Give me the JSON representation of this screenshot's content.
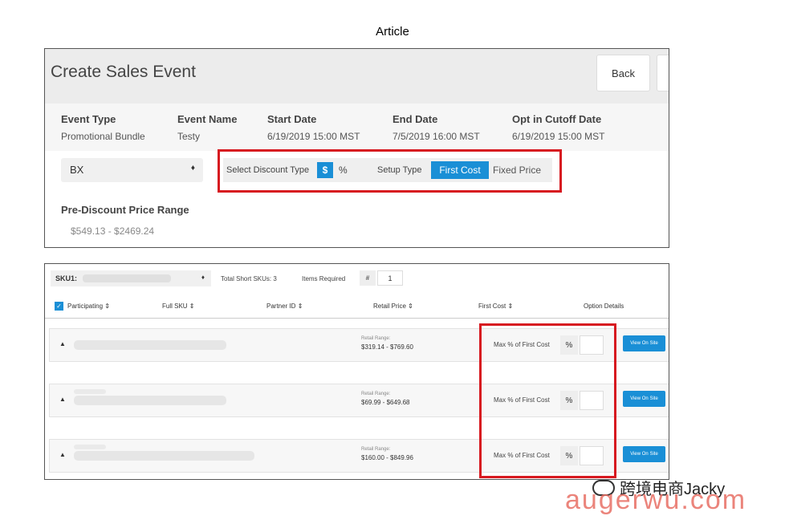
{
  "page_label": "Article",
  "panel1": {
    "title": "Create Sales Event",
    "back_label": "Back",
    "info": [
      {
        "header": "Event Type",
        "value": "Promotional Bundle"
      },
      {
        "header": "Event Name",
        "value": "Testy"
      },
      {
        "header": "Start Date",
        "value": "6/19/2019 15:00 MST"
      },
      {
        "header": "End Date",
        "value": "7/5/2019 16:00 MST"
      },
      {
        "header": "Opt in Cutoff Date",
        "value": "6/19/2019 15:00 MST"
      }
    ],
    "bx_select": "BX",
    "select_discount_type_label": "Select Discount Type",
    "dollar_label": "$",
    "percent_label": "%",
    "setup_type_label": "Setup Type",
    "first_cost_label": "First Cost",
    "fixed_price_label": "Fixed Price",
    "pre_discount_header": "Pre-Discount Price Range",
    "pre_discount_value": "$549.13 - $2469.24",
    "caret": "♦"
  },
  "panel2": {
    "sku_label": "SKU1:",
    "total_short_skus": "Total Short SKUs: 3",
    "items_required": "Items Required",
    "hash": "#",
    "items_required_value": "1",
    "columns": {
      "participating": "Participating",
      "full_sku": "Full SKU",
      "partner_id": "Partner ID",
      "retail_price": "Retail Price",
      "first_cost": "First Cost",
      "option_details": "Option Details"
    },
    "sort_icon": "⇕",
    "check": "✓",
    "rows": [
      {
        "retail_range_label": "Retail Range:",
        "retail_range": "$319.14 - $769.60",
        "max_label": "Max % of First Cost",
        "pct": "%",
        "view": "View On Site"
      },
      {
        "retail_range_label": "Retail Range:",
        "retail_range": "$69.99 - $649.68",
        "max_label": "Max % of First Cost",
        "pct": "%",
        "view": "View On Site"
      },
      {
        "retail_range_label": "Retail Range:",
        "retail_range": "$160.00 - $849.96",
        "max_label": "Max % of First Cost",
        "pct": "%",
        "view": "View On Site"
      }
    ],
    "row_caret": "▲"
  },
  "watermark": {
    "line1": "跨境电商Jacky",
    "line2": "augerwu.com"
  }
}
